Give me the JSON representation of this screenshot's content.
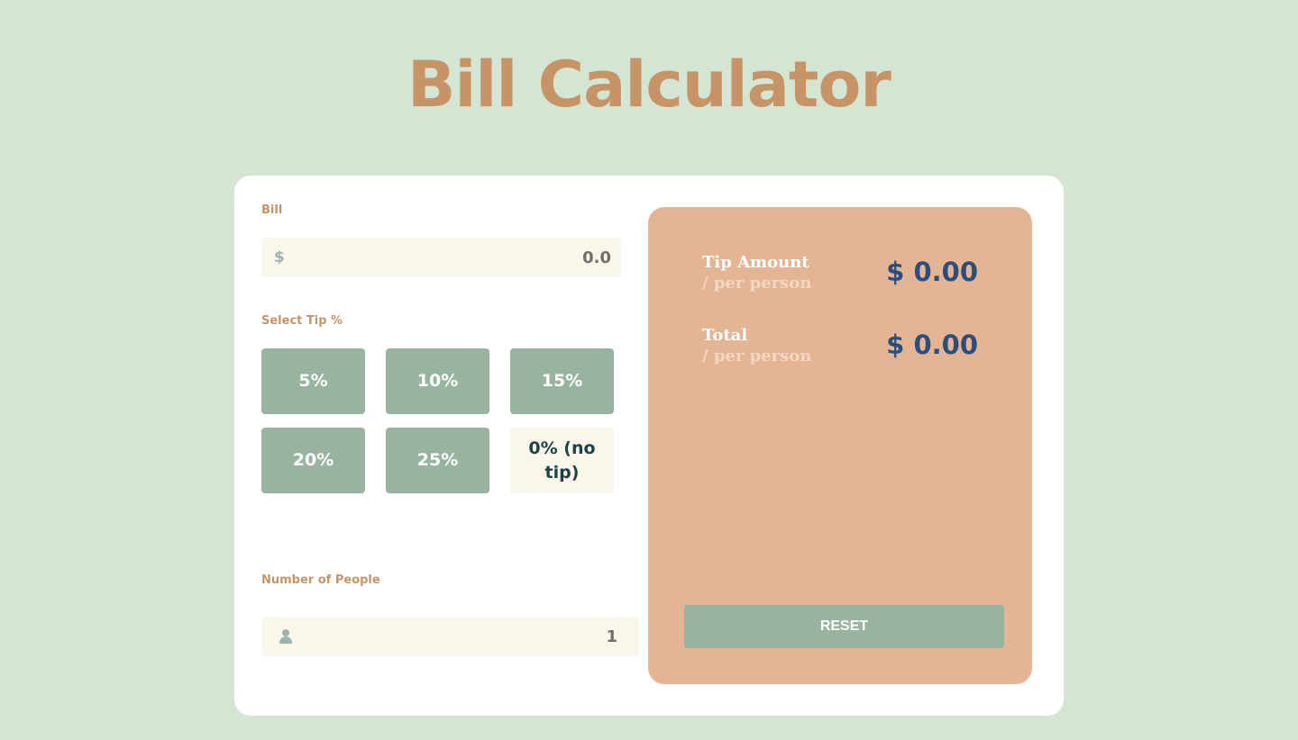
{
  "title": "Bill Calculator",
  "bill": {
    "label": "Bill",
    "currency_prefix": "$",
    "value": "0.0"
  },
  "tip": {
    "label": "Select Tip %",
    "options": [
      "5%",
      "10%",
      "15%",
      "20%",
      "25%",
      "0% (no tip)"
    ],
    "selected": "0% (no tip)"
  },
  "people": {
    "label": "Number of People",
    "icon": "person-icon",
    "value": "1"
  },
  "results": {
    "tip_amount_label": "Tip Amount",
    "tip_amount_sub": "/ per person",
    "tip_amount_value": "$ 0.00",
    "total_label": "Total",
    "total_sub": "/ per person",
    "total_value": "$ 0.00",
    "reset_label": "RESET"
  },
  "colors": {
    "page_background": "#d4e5d4",
    "title": "#c79468",
    "card": "#ffffff",
    "input_background": "#f9f6ea",
    "tip_button": "#99b3a1",
    "tip_button_selected": "#f9f6ea",
    "results_panel": "#e4b594",
    "result_value": "#2b4f7a",
    "reset_button": "#99b3a1"
  }
}
